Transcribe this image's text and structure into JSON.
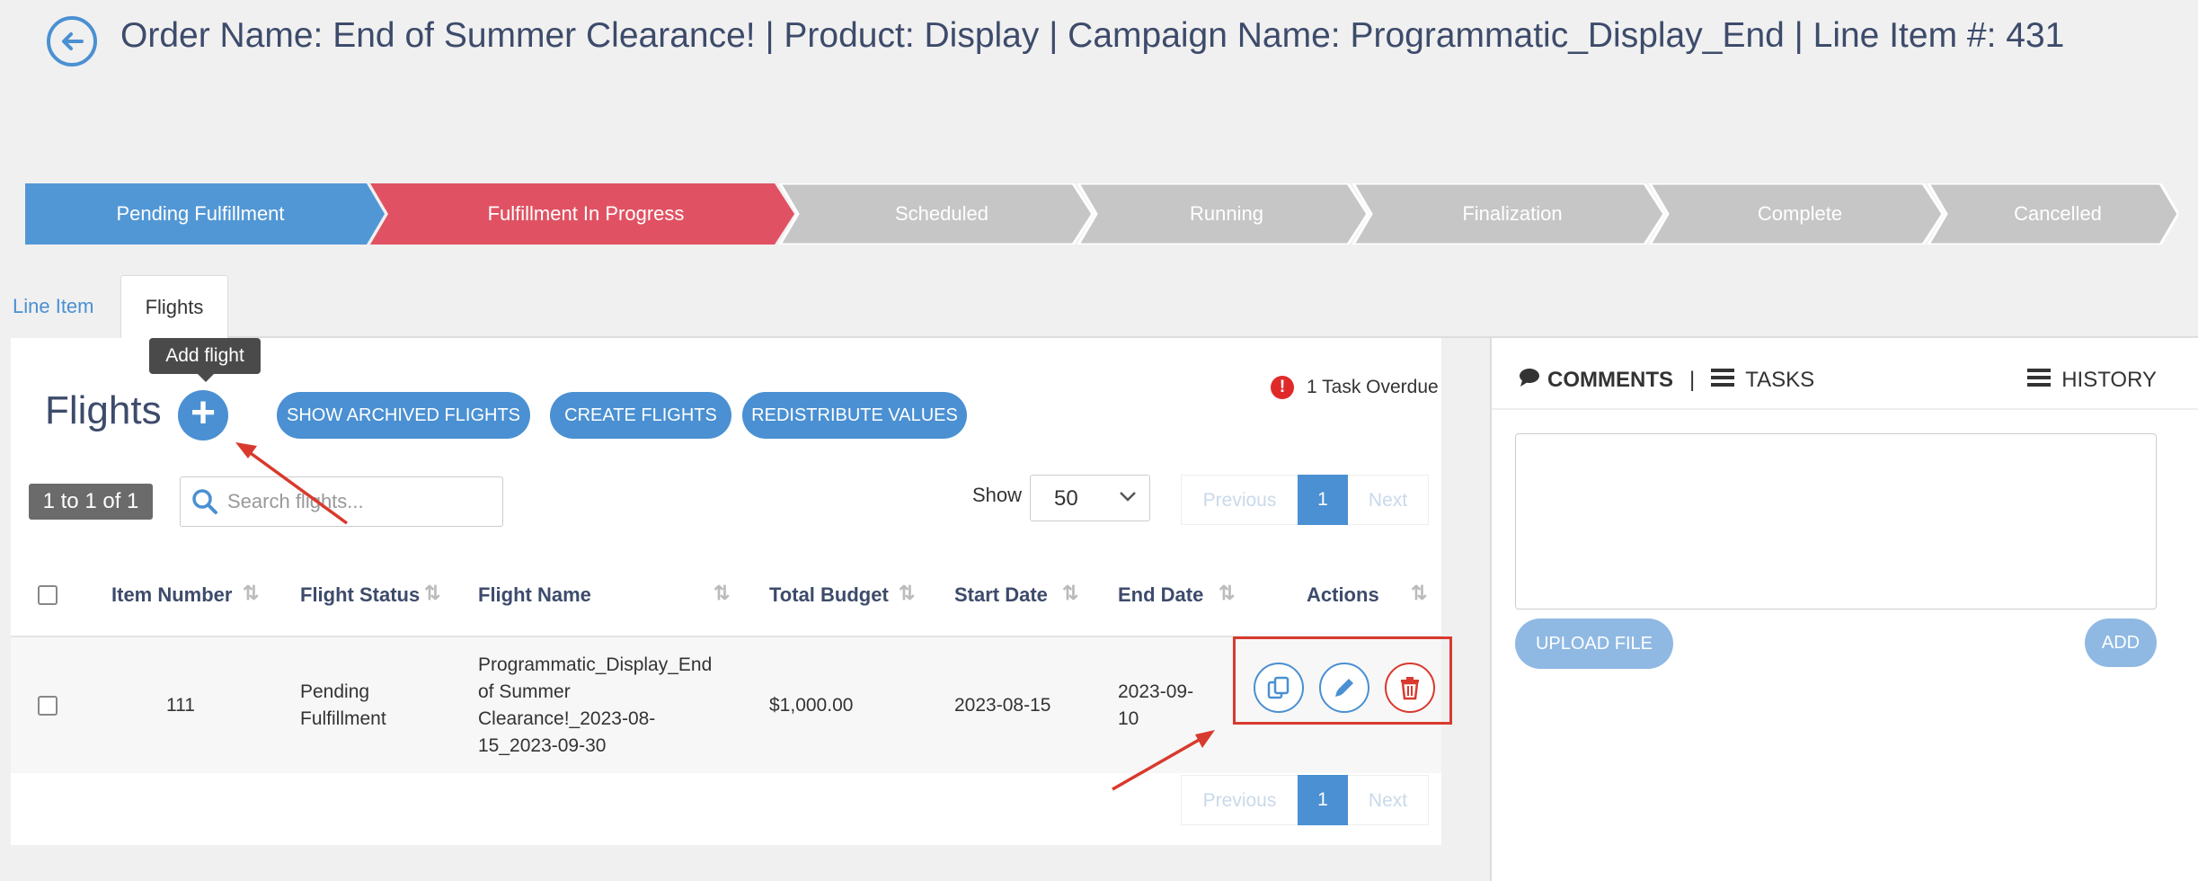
{
  "header": {
    "title": "Order Name: End of Summer Clearance! | Product: Display | Campaign Name: Programmatic_Display_End | Line Item #: 431",
    "back_icon": "arrow-left-circle-icon"
  },
  "pipeline": {
    "stages": [
      {
        "label": "Pending Fulfillment",
        "state": "done",
        "color": "#5297d5"
      },
      {
        "label": "Fulfillment In Progress",
        "state": "active",
        "color": "#e05263"
      },
      {
        "label": "Scheduled",
        "state": "pending",
        "color": "#c6c6c6"
      },
      {
        "label": "Running",
        "state": "pending",
        "color": "#c6c6c6"
      },
      {
        "label": "Finalization",
        "state": "pending",
        "color": "#c6c6c6"
      },
      {
        "label": "Complete",
        "state": "pending",
        "color": "#c6c6c6"
      },
      {
        "label": "Cancelled",
        "state": "pending",
        "color": "#c6c6c6"
      }
    ]
  },
  "tabs": {
    "line_item": "Line Item",
    "flights": "Flights",
    "active": "Flights"
  },
  "flights": {
    "title": "Flights",
    "add_tooltip": "Add flight",
    "add_symbol": "+",
    "buttons": {
      "show_archived": "SHOW ARCHIVED FLIGHTS",
      "create": "CREATE FLIGHTS",
      "redistribute": "REDISTRIBUTE VALUES"
    },
    "overdue": {
      "icon": "!",
      "text": "1 Task Overdue"
    },
    "count": "1 to 1 of 1",
    "search_placeholder": "Search flights...",
    "show_label": "Show",
    "page_size": "50",
    "pagination": {
      "previous": "Previous",
      "current": "1",
      "next": "Next"
    },
    "columns": [
      "Item Number",
      "Flight Status",
      "Flight Name",
      "Total Budget",
      "Start Date",
      "End Date",
      "Actions"
    ],
    "rows": [
      {
        "item_number": "111",
        "status_line1": "Pending",
        "status_line2": "Fulfillment",
        "name_line1": "Programmatic_Display_End",
        "name_line2": "of Summer",
        "name_line3": "Clearance!_2023-08-",
        "name_line4": "15_2023-09-30",
        "budget": "$1,000.00",
        "start_date": "2023-08-15",
        "end_line1": "2023-09-",
        "end_line2": "10",
        "actions": [
          "copy-icon",
          "pencil-icon",
          "trash-icon"
        ]
      }
    ]
  },
  "sidebar": {
    "comments": "COMMENTS",
    "separator": "|",
    "tasks": "TASKS",
    "history": "HISTORY",
    "upload": "UPLOAD FILE",
    "add": "ADD"
  },
  "colors": {
    "primary": "#4a90d2",
    "danger": "#d83a2e",
    "active_stage": "#e05263",
    "title": "#3d4b6b"
  }
}
